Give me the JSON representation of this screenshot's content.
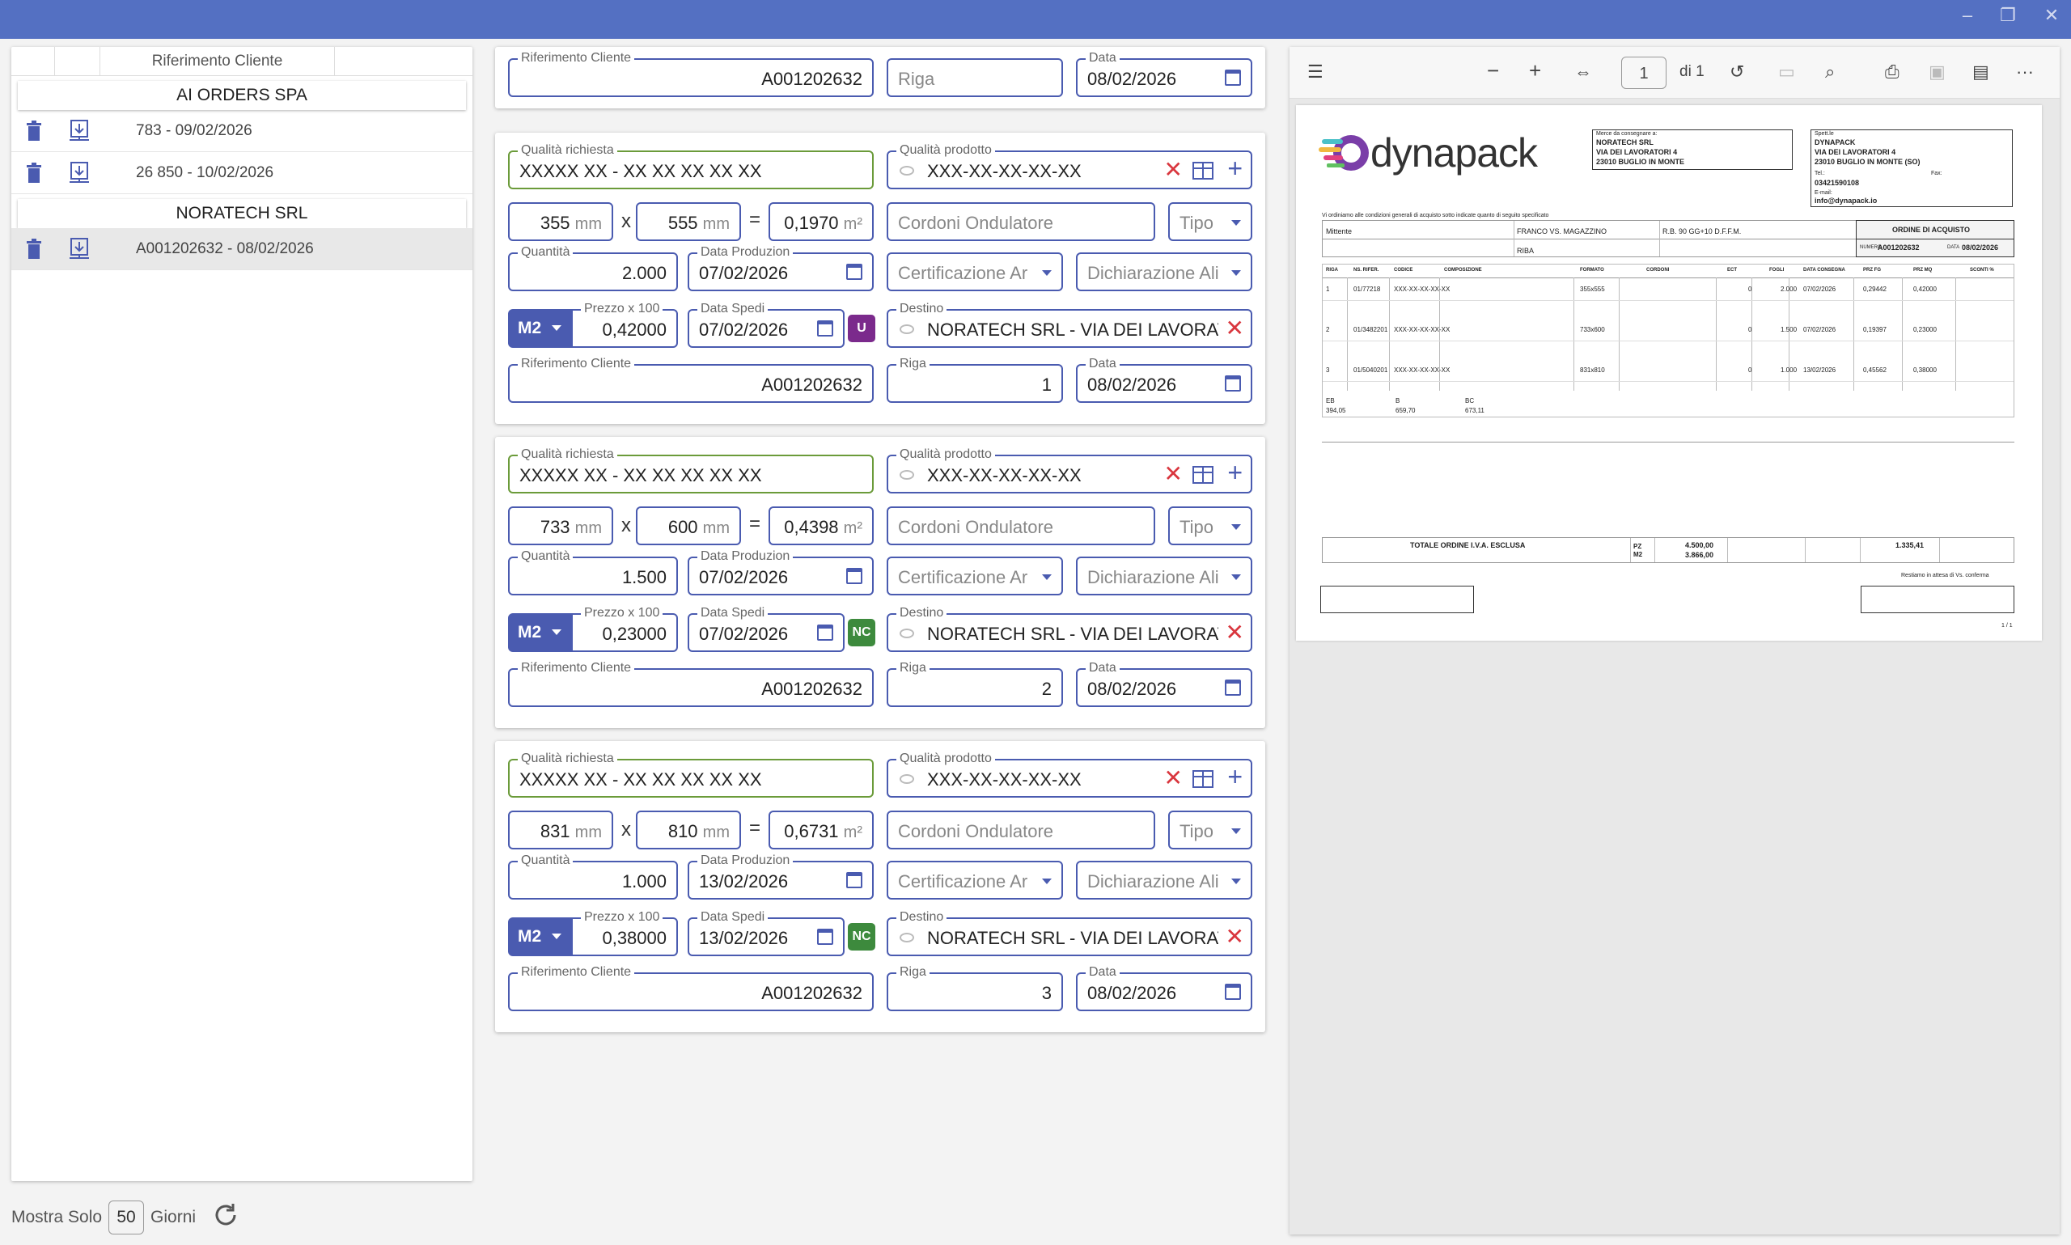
{
  "window": {
    "minimize": "–",
    "maximize": "❐",
    "close": "✕"
  },
  "left": {
    "column_header": "Riferimento Cliente",
    "groups": [
      {
        "name": "AI ORDERS SPA",
        "orders": [
          "783 - 09/02/2026",
          "26 850 - 10/02/2026"
        ]
      },
      {
        "name": "NORATECH SRL",
        "orders": [
          "A001202632 - 08/02/2026"
        ]
      }
    ],
    "footer": {
      "label": "Mostra Solo",
      "days": "50",
      "unit": "Giorni"
    }
  },
  "header_card": {
    "rif_label": "Riferimento Cliente",
    "rif_value": "A001202632",
    "riga_placeholder": "Riga",
    "data_label": "Data",
    "data_value": "08/02/2026"
  },
  "labels": {
    "qualita_richiesta": "Qualità richiesta",
    "qualita_prodotto": "Qualità prodotto",
    "cordoni": "Cordoni Ondulatore",
    "tipo": "Tipo",
    "quantita": "Quantità",
    "data_produzione": "Data Produzion",
    "certificazione": "Certificazione Ar",
    "dichiarazione": "Dichiarazione Ali",
    "prezzo": "Prezzo x 100",
    "data_spedizione": "Data Spedi",
    "destino": "Destino",
    "rif_cliente": "Riferimento Cliente",
    "riga": "Riga",
    "data": "Data",
    "mm": "mm",
    "m2unit": "m²",
    "x": "x",
    "eq": "="
  },
  "rows": [
    {
      "qualita_richiesta": "XXXXX XX - XX XX XX XX XX",
      "qualita_prodotto": "XXX-XX-XX-XX-XX",
      "width": "355",
      "height": "555",
      "area": "0,1970",
      "quantita": "2.000",
      "data_produzione": "07/02/2026",
      "um": "M2",
      "prezzo": "0,42000",
      "data_spedizione": "07/02/2026",
      "badge": "U",
      "badge_color": "#7b2a8c",
      "destino": "NORATECH SRL - VIA DEI LAVORATO",
      "rif_cliente": "A001202632",
      "riga": "1",
      "data": "08/02/2026"
    },
    {
      "qualita_richiesta": "XXXXX XX - XX XX XX XX XX",
      "qualita_prodotto": "XXX-XX-XX-XX-XX",
      "width": "733",
      "height": "600",
      "area": "0,4398",
      "quantita": "1.500",
      "data_produzione": "07/02/2026",
      "um": "M2",
      "prezzo": "0,23000",
      "data_spedizione": "07/02/2026",
      "badge": "NC",
      "badge_color": "#3d8a3d",
      "destino": "NORATECH SRL - VIA DEI LAVORATO",
      "rif_cliente": "A001202632",
      "riga": "2",
      "data": "08/02/2026"
    },
    {
      "qualita_richiesta": "XXXXX XX - XX XX XX XX XX",
      "qualita_prodotto": "XXX-XX-XX-XX-XX",
      "width": "831",
      "height": "810",
      "area": "0,6731",
      "quantita": "1.000",
      "data_produzione": "13/02/2026",
      "um": "M2",
      "prezzo": "0,38000",
      "data_spedizione": "13/02/2026",
      "badge": "NC",
      "badge_color": "#3d8a3d",
      "destino": "NORATECH SRL - VIA DEI LAVORATO",
      "rif_cliente": "A001202632",
      "riga": "3",
      "data": "08/02/2026"
    }
  ],
  "pdf": {
    "toolbar": {
      "page": "1",
      "of": "di 1",
      "minus": "−",
      "plus": "+",
      "more": "···"
    },
    "doc": {
      "logo": "dynapack",
      "consegna_label": "Merce da consegnare a:",
      "consegna": [
        "NORATECH SRL",
        "VIA DEI LAVORATORI 4",
        "23010 BUGLIO IN MONTE"
      ],
      "spett_label": "Spett.le",
      "spett": [
        "DYNAPACK",
        "VIA DEI LAVORATORI 4",
        "23010 BUGLIO IN MONTE (SO)"
      ],
      "tel_label": "Tel.:",
      "tel": "03421590108",
      "fax_label": "Fax:",
      "email_label": "E-mail:",
      "email": "info@dynapack.io",
      "note": "Vi ordiniamo alle condizioni generali di acquisto sotto indicate quanto di seguito specificato",
      "mittente": "Mittente",
      "porto": "FRANCO VS. MAGAZZINO",
      "termini": "R.B. 90 GG+10 D.F.F.M.",
      "pagamento": "RIBA",
      "title": "ORDINE DI ACQUISTO",
      "numero_label": "NUMERO",
      "numero": "A001202632",
      "data_label": "DATA",
      "data": "08/02/2026",
      "headers": [
        "RIGA",
        "NS. RIFER.",
        "CODICE",
        "COMPOSIZIONE",
        "FORMATO",
        "CORDONI",
        "ECT",
        "FOGLI",
        "DATA CONSEGNA",
        "PRZ FG",
        "PRZ MQ",
        "SCONTI %"
      ],
      "lines": [
        [
          "1",
          "01/77218",
          "XXX-XX-XX-XX-XX",
          "355x555",
          "0",
          "2.000",
          "07/02/2026",
          "0,29442",
          "0,42000"
        ],
        [
          "2",
          "01/3482201",
          "XXX-XX-XX-XX-XX",
          "733x600",
          "0",
          "1.500",
          "07/02/2026",
          "0,19397",
          "0,23000"
        ],
        [
          "3",
          "01/5040201",
          "XXX-XX-XX-XX-XX",
          "831x810",
          "0",
          "1.000",
          "13/02/2026",
          "0,45562",
          "0,38000"
        ]
      ],
      "waves": [
        "EB",
        "B",
        "BC"
      ],
      "wave_vals": [
        "394,05",
        "659,70",
        "673,11"
      ],
      "totale": "TOTALE ORDINE I.V.A. ESCLUSA",
      "pz": "PZ",
      "m2": "M2",
      "pz_val": "4.500,00",
      "m2_val": "3.866,00",
      "importo": "1.335,41",
      "conferma": "Restiamo in attesa di Vs. conferma",
      "pages": "1 / 1"
    }
  }
}
